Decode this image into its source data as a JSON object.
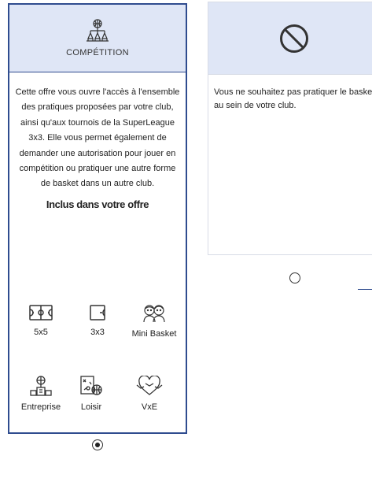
{
  "offers": {
    "competition": {
      "title": "COMPÉTITION",
      "icon": "tournament-bracket-icon",
      "description": "Cette offre vous ouvre l'accès à l'ensemble des pratiques proposées par votre club, ainsi qu'aux tournois de la SuperLeague 3x3. Elle vous permet également de demander une autorisation pour jouer en compétition ou pratiquer une autre forme de basket dans un autre club.",
      "included_title": "Inclus dans votre offre",
      "practices": [
        {
          "label": "5x5",
          "icon": "full-court-icon"
        },
        {
          "label": "3x3",
          "icon": "half-court-icon"
        },
        {
          "label": "Mini Basket",
          "icon": "kids-icon"
        },
        {
          "label": "Entreprise",
          "icon": "company-icon"
        },
        {
          "label": "Loisir",
          "icon": "leisure-icon"
        },
        {
          "label": "VxE",
          "icon": "heart-hands-icon"
        }
      ],
      "selected": true
    },
    "none": {
      "icon": "prohibited-icon",
      "description": "Vous ne souhaitez pas pratiquer le basket au sein de votre club.",
      "selected": false
    }
  },
  "colors": {
    "accent": "#2f4c8f",
    "header_bg": "#dfe6f6"
  }
}
